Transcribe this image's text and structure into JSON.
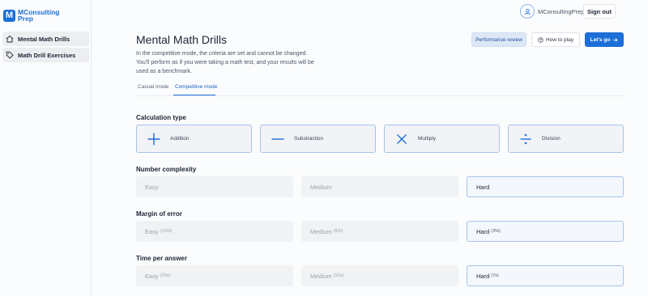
{
  "brand": {
    "line1": "MConsulting",
    "line2": "Prep",
    "mark": "M"
  },
  "sidebar": {
    "items": [
      {
        "label": "Mental Math Drills",
        "icon": "home-icon"
      },
      {
        "label": "Math Drill Exercises",
        "icon": "tag-icon"
      }
    ]
  },
  "user": {
    "name": "MConsultingPrep",
    "signout_label": "Sign out"
  },
  "header": {
    "title": "Mental Math Drills",
    "description": "In the competitive mode, the criteria are set and cannot be changed. You'll perform as if you were taking a math test, and your results will be used as a benchmark.",
    "performance_label": "Performance review",
    "how_label": "How to play",
    "go_label": "Let's go"
  },
  "tabs": [
    {
      "label": "Casual mode",
      "active": false
    },
    {
      "label": "Competitive mode",
      "active": true
    }
  ],
  "calculation": {
    "label": "Calculation type",
    "options": [
      {
        "label": "Addition",
        "icon": "plus-icon"
      },
      {
        "label": "Substraction",
        "icon": "minus-icon"
      },
      {
        "label": "Multiply",
        "icon": "multiply-icon"
      },
      {
        "label": "Division",
        "icon": "divide-icon"
      }
    ]
  },
  "complexity": {
    "label": "Number complexity",
    "options": [
      {
        "label": "Easy",
        "sub": ""
      },
      {
        "label": "Medium",
        "sub": ""
      },
      {
        "label": "Hard",
        "sub": "",
        "selected": true
      }
    ]
  },
  "margin": {
    "label": "Margin of error",
    "options": [
      {
        "label": "Easy",
        "sub": "(10%)"
      },
      {
        "label": "Medium",
        "sub": "(5%)"
      },
      {
        "label": "Hard",
        "sub": "(3%)",
        "selected": true
      }
    ]
  },
  "time": {
    "label": "Time per answer",
    "options": [
      {
        "label": "Easy",
        "sub": "(20s)"
      },
      {
        "label": "Medium",
        "sub": "(10s)"
      },
      {
        "label": "Hard",
        "sub": "(7s)",
        "selected": true
      }
    ]
  },
  "colors": {
    "accent": "#1c6fd8",
    "selected_border": "#a6c4ea"
  }
}
